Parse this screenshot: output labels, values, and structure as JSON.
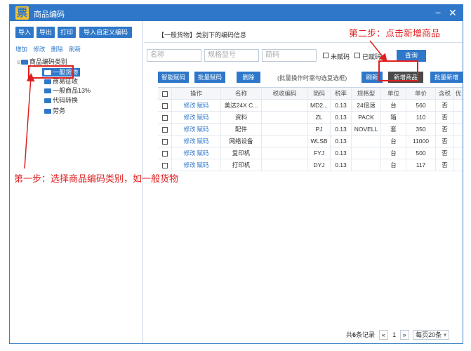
{
  "window": {
    "title": "商品编码",
    "logo_char": "票",
    "minimize": "−",
    "close": "✕"
  },
  "left": {
    "buttons": [
      "导入",
      "导出",
      "打印",
      "导入自定义编码"
    ],
    "links": [
      "增加",
      "修改",
      "删除",
      "刷新"
    ],
    "tree": {
      "root": "商品编码类别",
      "children": [
        "一般货物",
        "商易征收",
        "一般商品13%",
        "代码转换",
        "劳务"
      ]
    }
  },
  "right": {
    "category_title": "【一般货物】类别下的编码信息",
    "filters": {
      "name_placeholder": "名称",
      "spec_placeholder": "规格型号",
      "short_placeholder": "简码"
    },
    "check_unassigned": "未赋码",
    "check_assigned": "已赋码",
    "query": "查询",
    "actions": {
      "smart_assign": "智能赋码",
      "batch_assign": "批量赋码",
      "delete": "删除",
      "hint": "(批量操作时需勾选复选框)",
      "refresh": "刷新",
      "new_item": "新增商品",
      "batch_new": "批量新增"
    },
    "columns": [
      "操作",
      "名称",
      "税收编码",
      "简码",
      "税率",
      "规格型",
      "单位",
      "单价",
      "含税",
      "优"
    ],
    "op_edit": "修改",
    "op_assign": "赋码",
    "rows": [
      {
        "name": "美达24X C...",
        "tax_code": "",
        "short": "MD2...",
        "rate": "0.13",
        "spec": "24倍速",
        "unit": "台",
        "price": "560",
        "incl": "否"
      },
      {
        "name": "资料",
        "tax_code": "",
        "short": "ZL",
        "rate": "0.13",
        "spec": "PACK",
        "unit": "箱",
        "price": "110",
        "incl": "否"
      },
      {
        "name": "配件",
        "tax_code": "",
        "short": "PJ",
        "rate": "0.13",
        "spec": "NOVELL",
        "unit": "套",
        "price": "350",
        "incl": "否"
      },
      {
        "name": "网络设备",
        "tax_code": "",
        "short": "WLSB",
        "rate": "0.13",
        "spec": "",
        "unit": "台",
        "price": "11000",
        "incl": "否"
      },
      {
        "name": "复印机",
        "tax_code": "",
        "short": "FYJ",
        "rate": "0.13",
        "spec": "",
        "unit": "台",
        "price": "500",
        "incl": "否"
      },
      {
        "name": "打印机",
        "tax_code": "",
        "short": "DYJ",
        "rate": "0.13",
        "spec": "",
        "unit": "台",
        "price": "117",
        "incl": "否"
      }
    ],
    "pager": {
      "total_prefix": "共",
      "total": "6",
      "total_suffix": "条记录",
      "prev": "«",
      "page": "1",
      "next": "»",
      "per_page": "每页20条",
      "dropdown": "▾"
    }
  },
  "annotations": {
    "step1": "第一步：选择商品编码类别，如一般货物",
    "step2": "第二步：点击新增商品",
    "color": "#e02020"
  }
}
